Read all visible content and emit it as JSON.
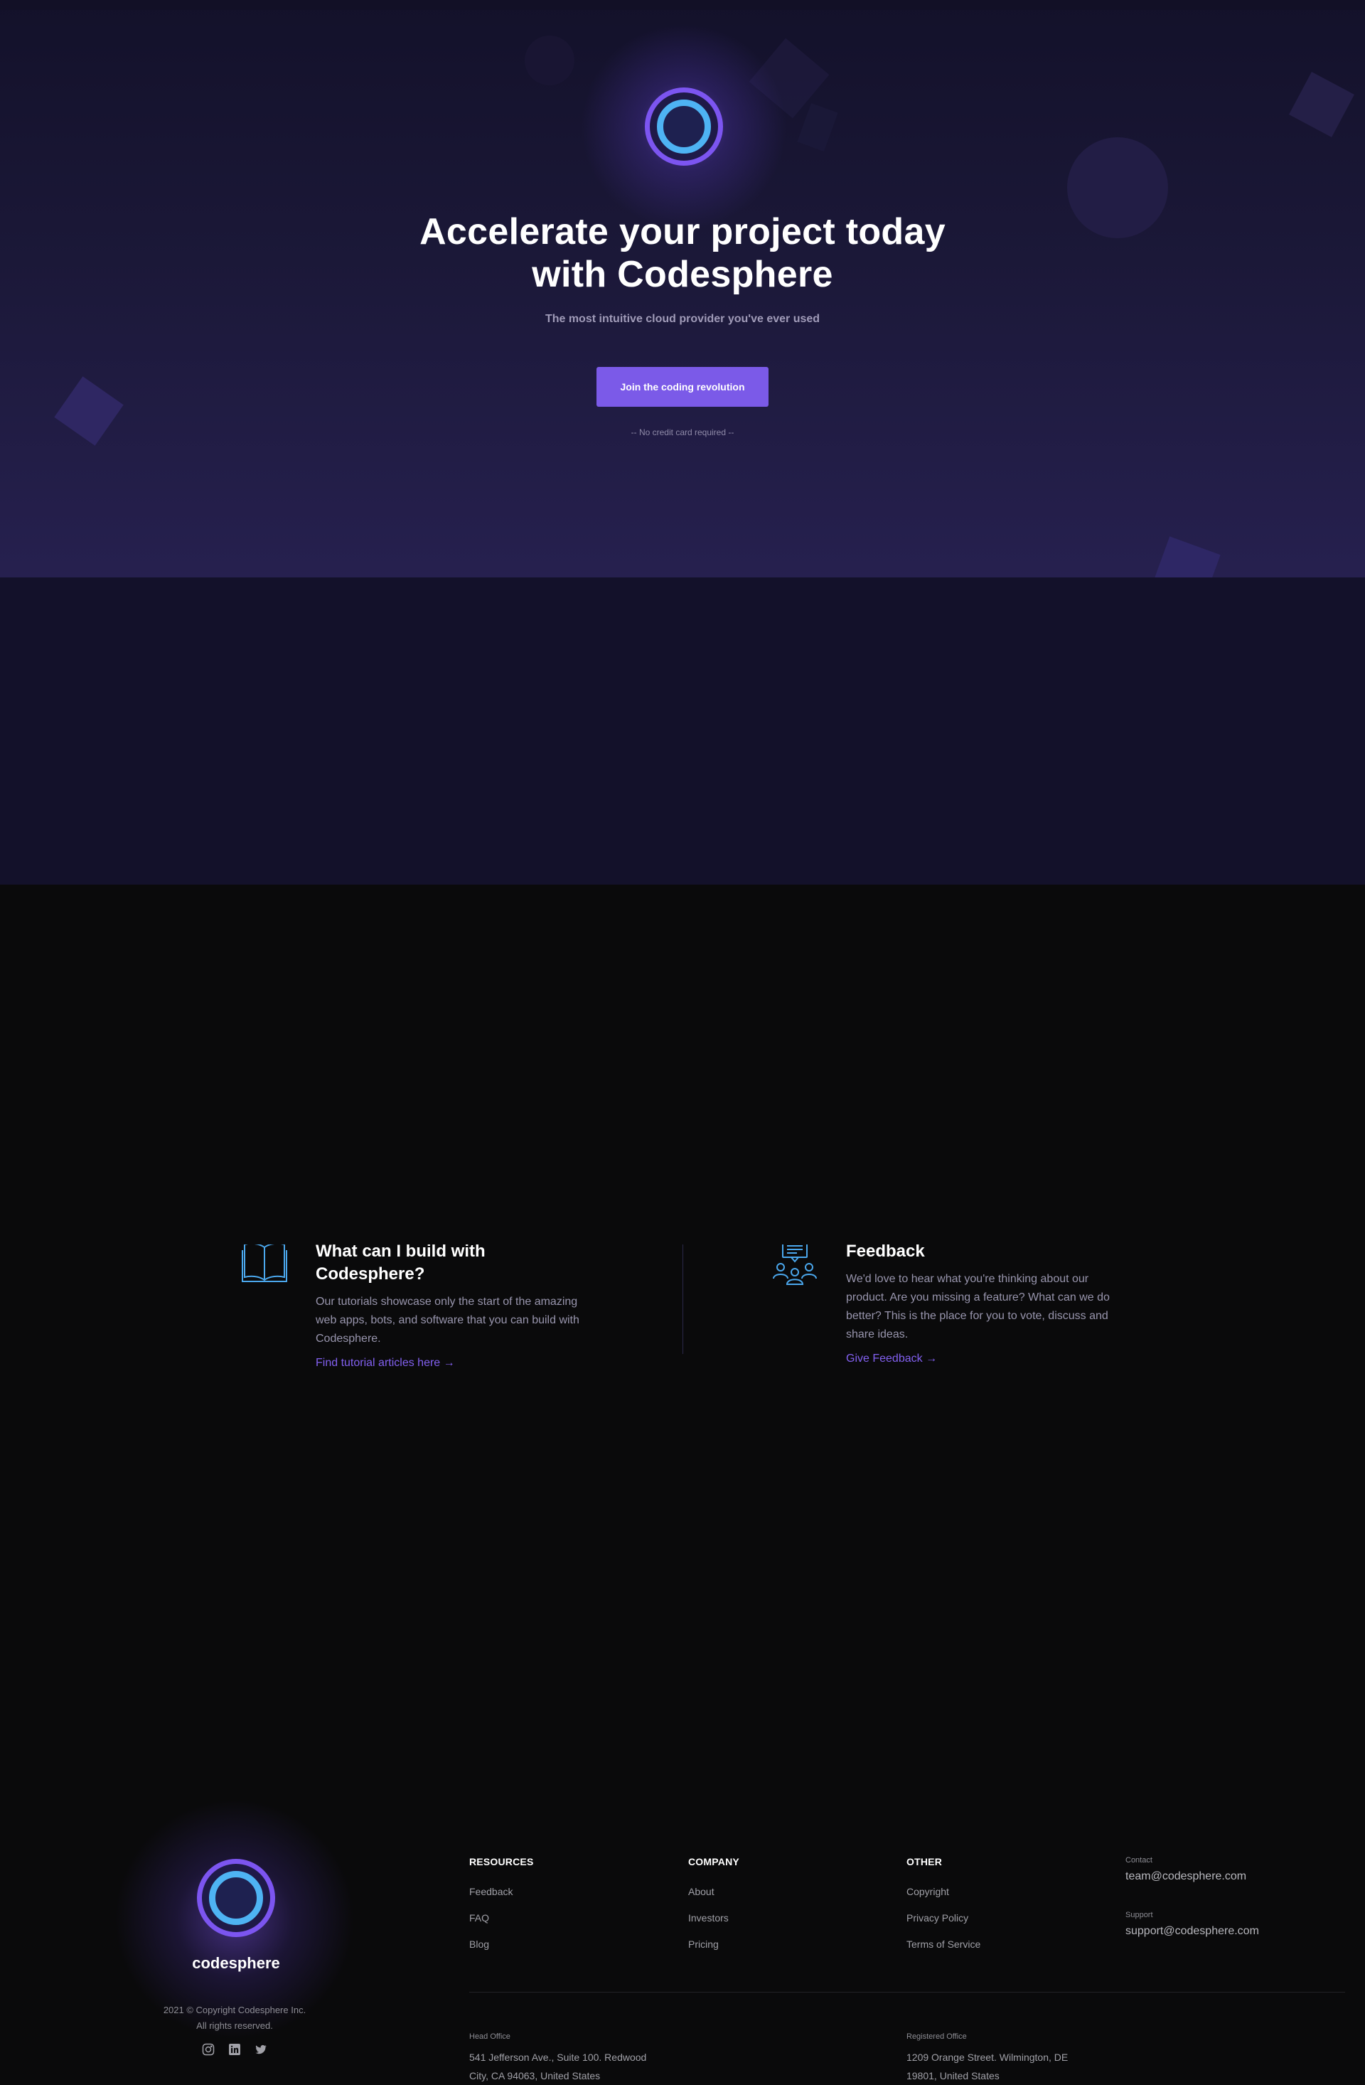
{
  "hero": {
    "title_line1": "Accelerate your project today",
    "title_line2": "with Codesphere",
    "subtitle": "The most intuitive cloud provider you've ever used",
    "cta_label": "Join the coding revolution",
    "note": "-- No credit card required --"
  },
  "features": [
    {
      "icon": "book-icon",
      "title_line1": "What can I build with",
      "title_line2": "Codesphere?",
      "description": "Our tutorials showcase only the start of the amazing web apps, bots, and software that you can build with Codesphere.",
      "link": "Find tutorial articles here"
    },
    {
      "icon": "community-feedback-icon",
      "title_line1": "Feedback",
      "description": "We'd love to hear what you're thinking about our product. Are you missing a feature? What can we do better? This is the place for you to vote, discuss and share ideas.",
      "link": "Give Feedback"
    }
  ],
  "footer": {
    "brand": "codesphere",
    "copyright_line1": "2021 © Copyright Codesphere Inc.",
    "copyright_line2": "All rights reserved.",
    "social": [
      "instagram-icon",
      "linkedin-icon",
      "twitter-icon"
    ],
    "columns": [
      {
        "heading": "RESOURCES",
        "items": [
          "Feedback",
          "FAQ",
          "Blog"
        ]
      },
      {
        "heading": "COMPANY",
        "items": [
          "About",
          "Investors",
          "Pricing"
        ]
      },
      {
        "heading": "OTHER",
        "items": [
          "Copyright",
          "Privacy Policy",
          "Terms of Service"
        ]
      }
    ],
    "contact": {
      "label": "Contact",
      "value": "team@codesphere.com"
    },
    "support": {
      "label": "Support",
      "value": "support@codesphere.com"
    },
    "head_office": {
      "label": "Head Office",
      "line1": "541 Jefferson Ave., Suite 100. Redwood",
      "line2": "City, CA 94063, United States"
    },
    "registered_office": {
      "label": "Registered Office",
      "line1": "1209 Orange Street. Wilmington, DE",
      "line2": "19801, United States"
    }
  },
  "colors": {
    "accent": "#7b5ae8",
    "ring_outer": "#7c55f0",
    "ring_inner": "#4eb3f3",
    "link": "#8260f0"
  }
}
